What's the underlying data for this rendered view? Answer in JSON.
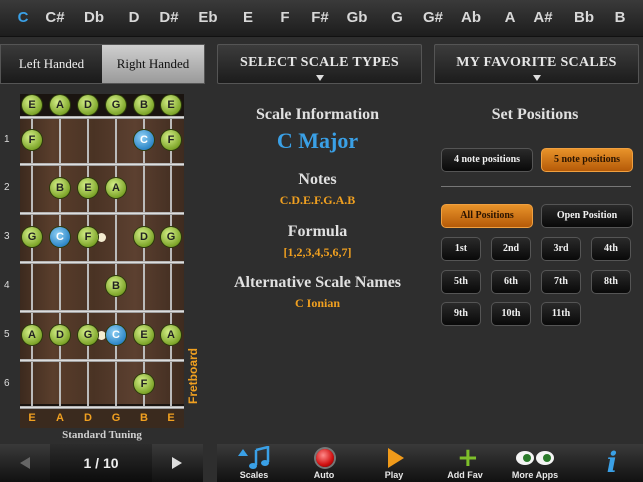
{
  "keys": [
    "C",
    "C#",
    "Db",
    "D",
    "D#",
    "Eb",
    "E",
    "F",
    "F#",
    "Gb",
    "G",
    "G#",
    "Ab",
    "A",
    "A#",
    "Bb",
    "B"
  ],
  "selected_key_index": 0,
  "hand": {
    "left": "Left Handed",
    "right": "Right Handed"
  },
  "menus": {
    "scale_types": "SELECT SCALE TYPES",
    "favorites": "MY FAVORITE SCALES"
  },
  "fretboard": {
    "open_strings": [
      "E",
      "A",
      "D",
      "G",
      "B",
      "E"
    ],
    "bottom_strings": [
      "E",
      "A",
      "D",
      "G",
      "B",
      "E"
    ],
    "fret_numbers": [
      "1",
      "2",
      "3",
      "4",
      "5",
      "6"
    ],
    "label": "Fretboard",
    "tuning": "Standard Tuning",
    "notes": [
      {
        "fret": 1,
        "string": 0,
        "name": "F",
        "root": false
      },
      {
        "fret": 1,
        "string": 4,
        "name": "C",
        "root": true
      },
      {
        "fret": 1,
        "string": 5,
        "name": "F",
        "root": false
      },
      {
        "fret": 2,
        "string": 1,
        "name": "B",
        "root": false
      },
      {
        "fret": 2,
        "string": 2,
        "name": "E",
        "root": false
      },
      {
        "fret": 2,
        "string": 3,
        "name": "A",
        "root": false
      },
      {
        "fret": 3,
        "string": 0,
        "name": "G",
        "root": false
      },
      {
        "fret": 3,
        "string": 1,
        "name": "C",
        "root": true
      },
      {
        "fret": 3,
        "string": 2,
        "name": "F",
        "root": false
      },
      {
        "fret": 3,
        "string": 4,
        "name": "D",
        "root": false
      },
      {
        "fret": 3,
        "string": 5,
        "name": "G",
        "root": false
      },
      {
        "fret": 4,
        "string": 3,
        "name": "B",
        "root": false
      },
      {
        "fret": 5,
        "string": 0,
        "name": "A",
        "root": false
      },
      {
        "fret": 5,
        "string": 1,
        "name": "D",
        "root": false
      },
      {
        "fret": 5,
        "string": 2,
        "name": "G",
        "root": false
      },
      {
        "fret": 5,
        "string": 3,
        "name": "C",
        "root": true
      },
      {
        "fret": 5,
        "string": 4,
        "name": "E",
        "root": false
      },
      {
        "fret": 5,
        "string": 5,
        "name": "A",
        "root": false
      },
      {
        "fret": 6,
        "string": 4,
        "name": "F",
        "root": false
      }
    ]
  },
  "info": {
    "heading": "Scale Information",
    "scale_name": "C Major",
    "notes_heading": "Notes",
    "notes_value": "C.D.E.F.G.A.B",
    "formula_heading": "Formula",
    "formula_value": "[1,2,3,4,5,6,7]",
    "alt_heading": "Alternative Scale Names",
    "alt_value": "C Ionian"
  },
  "positions": {
    "heading": "Set Positions",
    "four_note": "4 note positions",
    "five_note": "5 note positions",
    "all": "All Positions",
    "open": "Open Position",
    "items": [
      "1st",
      "2nd",
      "3rd",
      "4th",
      "5th",
      "6th",
      "7th",
      "8th",
      "9th",
      "10th",
      "11th"
    ]
  },
  "pager": {
    "text": "1 / 10"
  },
  "toolbar": {
    "scales": "Scales",
    "auto": "Auto",
    "play": "Play",
    "add_fav": "Add Fav",
    "more_apps": "More Apps"
  },
  "colors": {
    "accent_blue": "#3aa0e6",
    "orange": "#f0a020",
    "note_green": "#7ea62a",
    "root_blue": "#2f88c8"
  }
}
